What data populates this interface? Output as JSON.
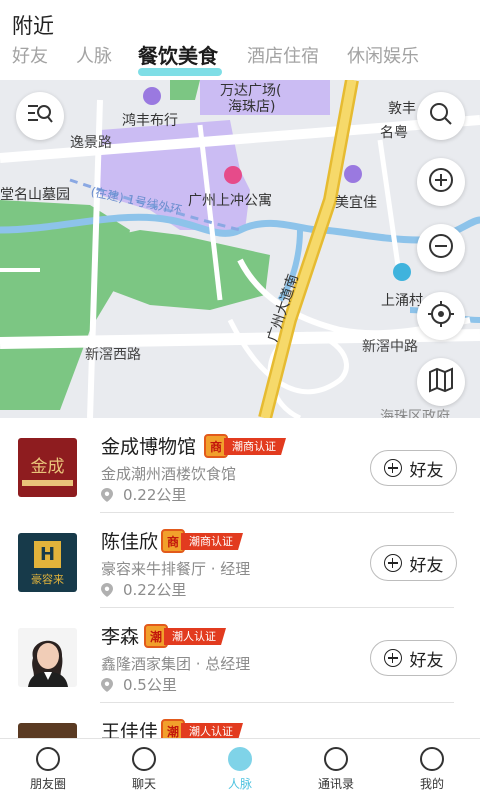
{
  "header": {
    "title": "附近"
  },
  "tabs": [
    {
      "label": "好友"
    },
    {
      "label": "人脉"
    },
    {
      "label": "餐饮美食",
      "active": true
    },
    {
      "label": "酒店住宿"
    },
    {
      "label": "休闲娱乐"
    }
  ],
  "map": {
    "labels": {
      "wanda": "万达广场(",
      "wanda2": "海珠店)",
      "hongfeng": "鸿丰布行",
      "yijing": "逸景路",
      "cemetery": "堂名山墓园",
      "metro": "(在建) 1号线外环",
      "apartment": "广州上冲公寓",
      "meiyijia": "美宜佳",
      "dunhe": "敦丰",
      "mingyue": "名粤",
      "shangyong": "上涌村",
      "xinjiao_w": "新滘西路",
      "xinjiao_m": "新滘中路",
      "avenue": "广州大道南",
      "bottom": "海珠区政府"
    },
    "controls": [
      "list-search-icon",
      "search-icon",
      "zoom-in-icon",
      "zoom-out-icon",
      "locate-icon",
      "map-layers-icon"
    ]
  },
  "list": [
    {
      "name": "金成博物馆",
      "badge": "潮商认证",
      "seal": "商",
      "sub": "金成潮州酒楼饮食馆",
      "distance": "0.22公里",
      "add": "好友"
    },
    {
      "name": "陈佳欣",
      "badge": "潮商认证",
      "seal": "商",
      "sub": "豪容来牛排餐厅 · 经理",
      "distance": "0.22公里",
      "add": "好友"
    },
    {
      "name": "李森",
      "badge": "潮人认证",
      "seal": "潮",
      "sub": "鑫隆酒家集团 · 总经理",
      "distance": "0.5公里",
      "add": "好友"
    },
    {
      "name": "王佳佳",
      "badge": "潮人认证",
      "seal": "潮",
      "sub": "",
      "distance": "",
      "add": ""
    }
  ],
  "avatars": {
    "jincheng_text": "金成",
    "haorong_text": "豪容来"
  },
  "nav": [
    {
      "label": "朋友圈",
      "icon": "camera-icon"
    },
    {
      "label": "聊天",
      "icon": "chat-icon"
    },
    {
      "label": "人脉",
      "icon": "contacts-icon",
      "active": true
    },
    {
      "label": "通讯录",
      "icon": "address-book-icon"
    },
    {
      "label": "我的",
      "icon": "profile-icon"
    }
  ],
  "colors": {
    "accent": "#5fd6e0",
    "badge_red": "#e23b1f",
    "seal_orange": "#f1a02c",
    "road_yellow": "#f4d03f",
    "park_green": "#74c27a",
    "water_blue": "#8fc3ea"
  }
}
